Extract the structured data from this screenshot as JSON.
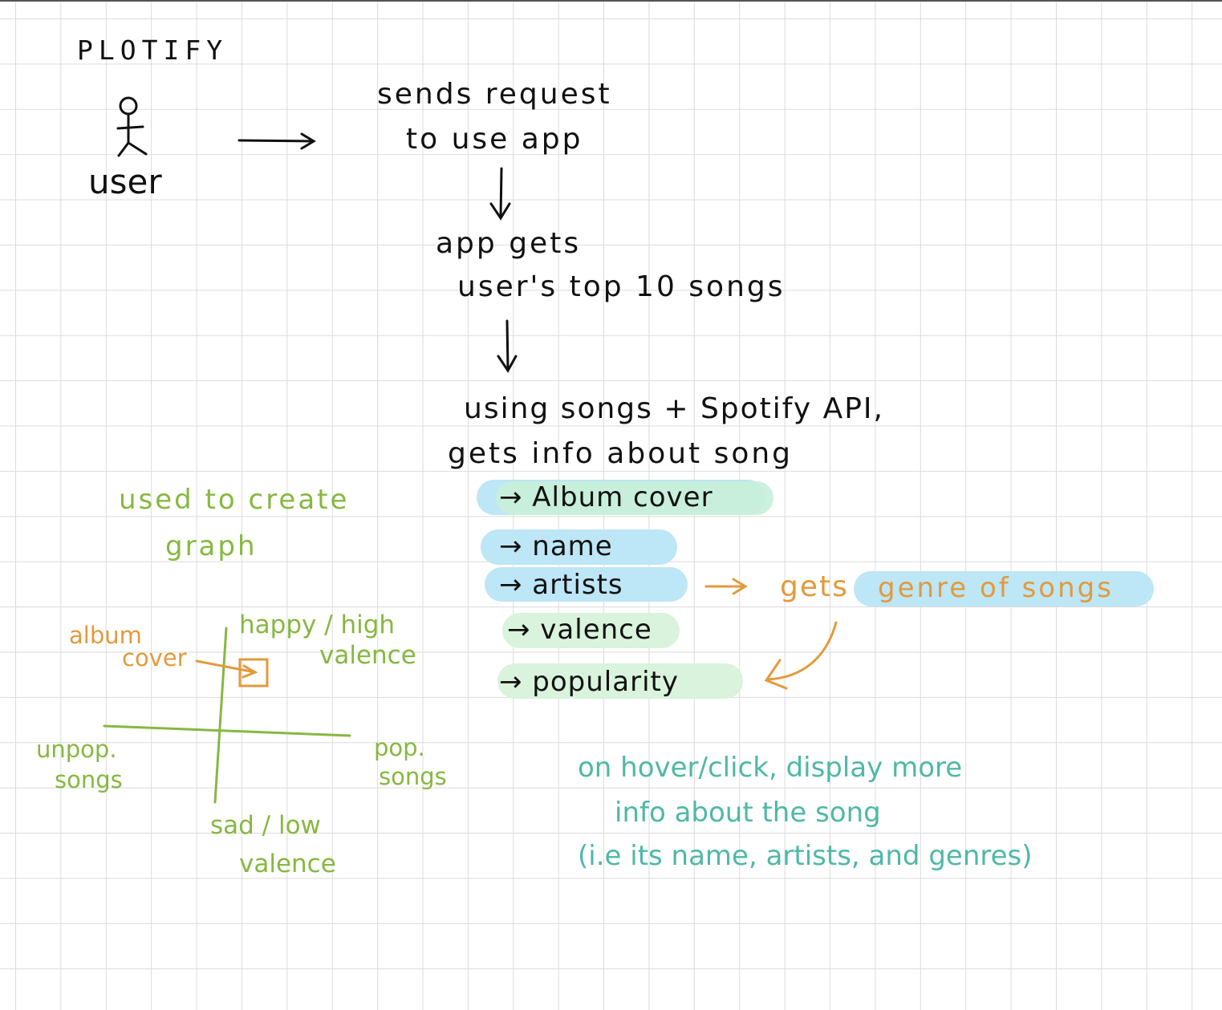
{
  "title": "PLOTIFY",
  "actor": {
    "label": "user"
  },
  "flow": {
    "step1": [
      "sends request",
      "to use app"
    ],
    "step2": [
      "app gets",
      "user's top 10 songs"
    ],
    "step3": [
      "using songs + Spotify API,",
      "gets info about song"
    ]
  },
  "info_items": [
    {
      "label": "→ Album cover"
    },
    {
      "label": "→ name"
    },
    {
      "label": "→ artists"
    },
    {
      "label": "→ valence"
    },
    {
      "label": "→ popularity"
    }
  ],
  "genre_branch": {
    "gets": "gets",
    "genre": "genre of songs"
  },
  "graph_note": [
    "used to create",
    "graph"
  ],
  "graph": {
    "top_label": [
      "happy / high",
      "valence"
    ],
    "bottom_label": [
      "sad / low",
      "valence"
    ],
    "left_label": [
      "unpop.",
      "songs"
    ],
    "right_label": [
      "pop.",
      "songs"
    ],
    "marker_label": [
      "album",
      "cover"
    ]
  },
  "hover_note": [
    "on hover/click, display more",
    "info about the song",
    "(i.e its name, artists, and genres)"
  ],
  "colors": {
    "ink": "#111111",
    "green": "#86b840",
    "orange": "#e39a3c",
    "teal": "#4fb8a7",
    "highlight_blue": "#bde6f6",
    "highlight_green": "#c9efd9"
  }
}
